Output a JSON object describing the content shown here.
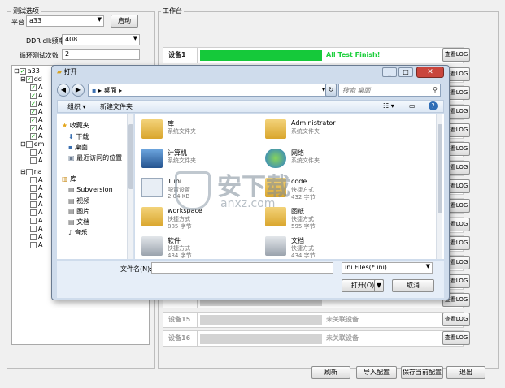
{
  "left_panel": {
    "group_title": "测试选项",
    "platform_label": "平台",
    "platform_value": "a33",
    "start_button": "启动",
    "ddr_label": "DDR clk频率",
    "ddr_value": "408",
    "loop_label": "循环测试次数",
    "loop_value": "2",
    "tree": [
      {
        "label": "a33",
        "level": 0
      },
      {
        "label": "dd",
        "level": 1
      },
      {
        "label": "A",
        "level": 2
      },
      {
        "label": "A",
        "level": 2
      },
      {
        "label": "A",
        "level": 2
      },
      {
        "label": "A",
        "level": 2
      },
      {
        "label": "A",
        "level": 2
      },
      {
        "label": "A",
        "level": 2
      },
      {
        "label": "A",
        "level": 2
      },
      {
        "label": "em",
        "level": 1
      },
      {
        "label": "A",
        "level": 2
      },
      {
        "label": "A",
        "level": 2
      },
      {
        "label": "na",
        "level": 1
      },
      {
        "label": "A",
        "level": 2
      },
      {
        "label": "A",
        "level": 2
      },
      {
        "label": "A",
        "level": 2
      },
      {
        "label": "A",
        "level": 2
      },
      {
        "label": "A",
        "level": 2
      },
      {
        "label": "A",
        "level": 2
      },
      {
        "label": "A",
        "level": 2
      },
      {
        "label": "A",
        "level": 2
      },
      {
        "label": "A",
        "level": 2
      }
    ]
  },
  "workbench": {
    "group_title": "工作台",
    "devices": [
      {
        "name": "设备1",
        "status": "All Test Finish!",
        "log": "查看LOG",
        "active": true
      },
      {
        "name": "",
        "status": "",
        "log": "查看LOG",
        "active": false
      },
      {
        "name": "",
        "status": "",
        "log": "查看LOG",
        "active": false
      },
      {
        "name": "",
        "status": "",
        "log": "查看LOG",
        "active": false
      },
      {
        "name": "",
        "status": "",
        "log": "查看LOG",
        "active": false
      },
      {
        "name": "",
        "status": "",
        "log": "查看LOG",
        "active": false
      },
      {
        "name": "",
        "status": "",
        "log": "查看LOG",
        "active": false
      },
      {
        "name": "",
        "status": "",
        "log": "查看LOG",
        "active": false
      },
      {
        "name": "",
        "status": "",
        "log": "查看LOG",
        "active": false
      },
      {
        "name": "",
        "status": "",
        "log": "查看LOG",
        "active": false
      },
      {
        "name": "",
        "status": "",
        "log": "查看LOG",
        "active": false
      },
      {
        "name": "",
        "status": "",
        "log": "查看LOG",
        "active": false
      },
      {
        "name": "",
        "status": "",
        "log": "查看LOG",
        "active": false
      },
      {
        "name": "",
        "status": "",
        "log": "查看LOG",
        "active": false
      },
      {
        "name": "设备15",
        "status": "未关联设备",
        "log": "查看LOG",
        "active": false
      },
      {
        "name": "设备16",
        "status": "未关联设备",
        "log": "查看LOG",
        "active": false
      }
    ]
  },
  "bottom_buttons": {
    "refresh": "刷新",
    "import": "导入配置",
    "save": "保存当前配置",
    "exit": "退出"
  },
  "dialog": {
    "title": "打开",
    "address": "桌面",
    "search_placeholder": "搜索 桌面",
    "organize": "组织 ▾",
    "new_folder": "新建文件夹",
    "nav": {
      "favorites": "收藏夹",
      "downloads": "下载",
      "desktop": "桌面",
      "recent": "最近访问的位置",
      "libraries": "库",
      "subversion": "Subversion",
      "videos": "视频",
      "pictures": "图片",
      "documents": "文档",
      "music": "音乐"
    },
    "files": [
      {
        "name": "库",
        "sub": "系统文件夹",
        "sub2": ""
      },
      {
        "name": "Administrator",
        "sub": "系统文件夹",
        "sub2": ""
      },
      {
        "name": "计算机",
        "sub": "系统文件夹",
        "sub2": ""
      },
      {
        "name": "网络",
        "sub": "系统文件夹",
        "sub2": ""
      },
      {
        "name": "1.ini",
        "sub": "配置设置",
        "sub2": "2.04 KB"
      },
      {
        "name": "code",
        "sub": "快捷方式",
        "sub2": "432 字节"
      },
      {
        "name": "workspace",
        "sub": "快捷方式",
        "sub2": "885 字节"
      },
      {
        "name": "图纸",
        "sub": "快捷方式",
        "sub2": "595 字节"
      },
      {
        "name": "软件",
        "sub": "快捷方式",
        "sub2": "434 字节"
      },
      {
        "name": "文档",
        "sub": "快捷方式",
        "sub2": "434 字节"
      }
    ],
    "filename_label": "文件名(N):",
    "filename_value": "",
    "filter_value": "ini Files(*.ini)",
    "open_button": "打开(O)",
    "cancel_button": "取消"
  },
  "watermark": {
    "cn": "安下载",
    "en": "anxz.com"
  }
}
